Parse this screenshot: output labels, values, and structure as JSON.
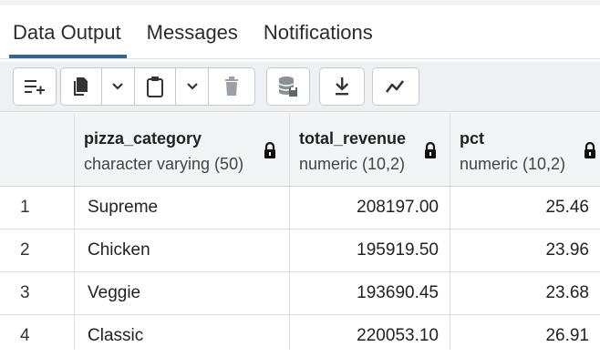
{
  "tabs": [
    {
      "label": "Data Output",
      "active": true
    },
    {
      "label": "Messages",
      "active": false
    },
    {
      "label": "Notifications",
      "active": false
    }
  ],
  "toolbar": {
    "icons": [
      "add-row-icon",
      "copy-icon",
      "chevron-down-icon",
      "paste-icon",
      "chevron-down-icon",
      "delete-icon",
      "save-data-icon",
      "download-icon",
      "graph-icon"
    ]
  },
  "columns": [
    {
      "name": "",
      "type": ""
    },
    {
      "name": "pizza_category",
      "type": "character varying (50)"
    },
    {
      "name": "total_revenue",
      "type": "numeric (10,2)"
    },
    {
      "name": "pct",
      "type": "numeric (10,2)"
    }
  ],
  "rows": [
    {
      "num": "1",
      "pizza_category": "Supreme",
      "total_revenue": "208197.00",
      "pct": "25.46"
    },
    {
      "num": "2",
      "pizza_category": "Chicken",
      "total_revenue": "195919.50",
      "pct": "23.96"
    },
    {
      "num": "3",
      "pizza_category": "Veggie",
      "total_revenue": "193690.45",
      "pct": "23.68"
    },
    {
      "num": "4",
      "pizza_category": "Classic",
      "total_revenue": "220053.10",
      "pct": "26.91"
    }
  ],
  "colors": {
    "accent": "#326690",
    "toolbar_bg": "#eef0f3",
    "header_bg": "#f3f4f6"
  }
}
